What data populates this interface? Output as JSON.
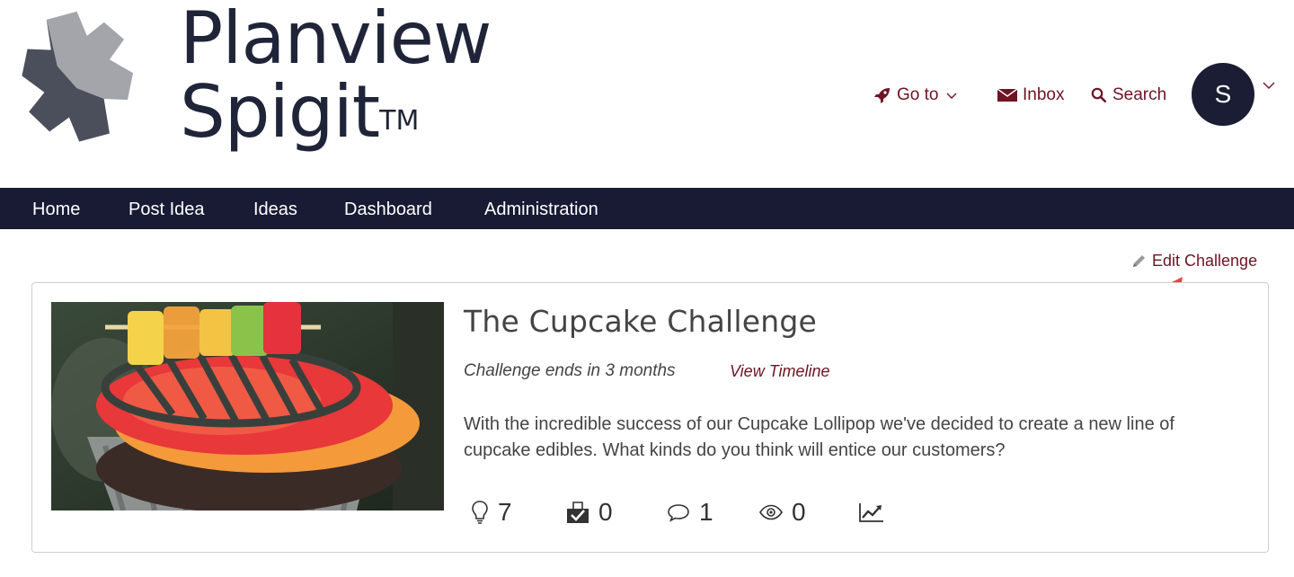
{
  "brand": {
    "line1": "Planview",
    "line2": "Spigit",
    "tm": "TM"
  },
  "topnav": {
    "goto_label": "Go to",
    "inbox_label": "Inbox",
    "search_label": "Search",
    "avatar_initial": "S"
  },
  "navbar": {
    "items": [
      {
        "label": "Home"
      },
      {
        "label": "Post Idea"
      },
      {
        "label": "Ideas"
      },
      {
        "label": "Dashboard"
      },
      {
        "label": "Administration"
      }
    ]
  },
  "edit_label": "Edit Challenge",
  "challenge": {
    "title": "The Cupcake Challenge",
    "ends_text": "Challenge ends in 3 months",
    "timeline_label": "View Timeline",
    "description": "With the incredible success of our Cupcake Lollipop we've decided to create a new line of cupcake edibles. What kinds do you think will entice our customers?",
    "stats": {
      "ideas": "7",
      "votes": "0",
      "comments": "1",
      "views": "0"
    }
  },
  "colors": {
    "accent": "#6e1423",
    "navbar": "#191b35",
    "arrow": "#e8453c"
  }
}
